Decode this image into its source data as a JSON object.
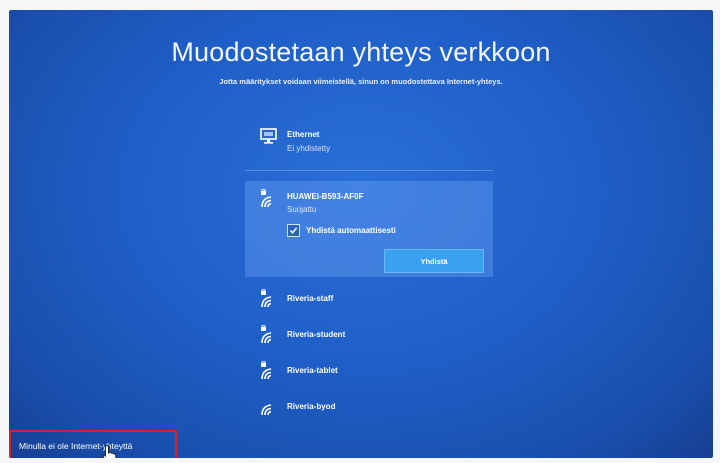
{
  "page": {
    "title": "Muodostetaan yhteys verkkoon",
    "subtitle": "Jotta määritykset voidaan viimeistellä, sinun on muodostettava Internet-yhteys."
  },
  "ethernet": {
    "name": "Ethernet",
    "status": "Ei yhdistetty",
    "icon": "ethernet-monitor-icon"
  },
  "selected_network": {
    "name": "HUAWEI-B593-AF0F",
    "status": "Suojattu",
    "auto_connect_label": "Yhdistä automaattisesti",
    "auto_connect_checked": true,
    "connect_button": "Yhdistä",
    "icon": "wifi-secured-icon"
  },
  "networks": [
    {
      "name": "Riveria-staff",
      "icon": "wifi-secured-icon"
    },
    {
      "name": "Riveria-student",
      "icon": "wifi-secured-icon"
    },
    {
      "name": "Riveria-tablet",
      "icon": "wifi-secured-icon"
    },
    {
      "name": "Riveria-byod",
      "icon": "wifi-icon"
    }
  ],
  "footer": {
    "no_internet_label": "Minulla ei ole Internet-yhteyttä"
  },
  "colors": {
    "background": "#1f5fc8",
    "highlight": "#d0242e",
    "button": "#3aa0f0"
  }
}
